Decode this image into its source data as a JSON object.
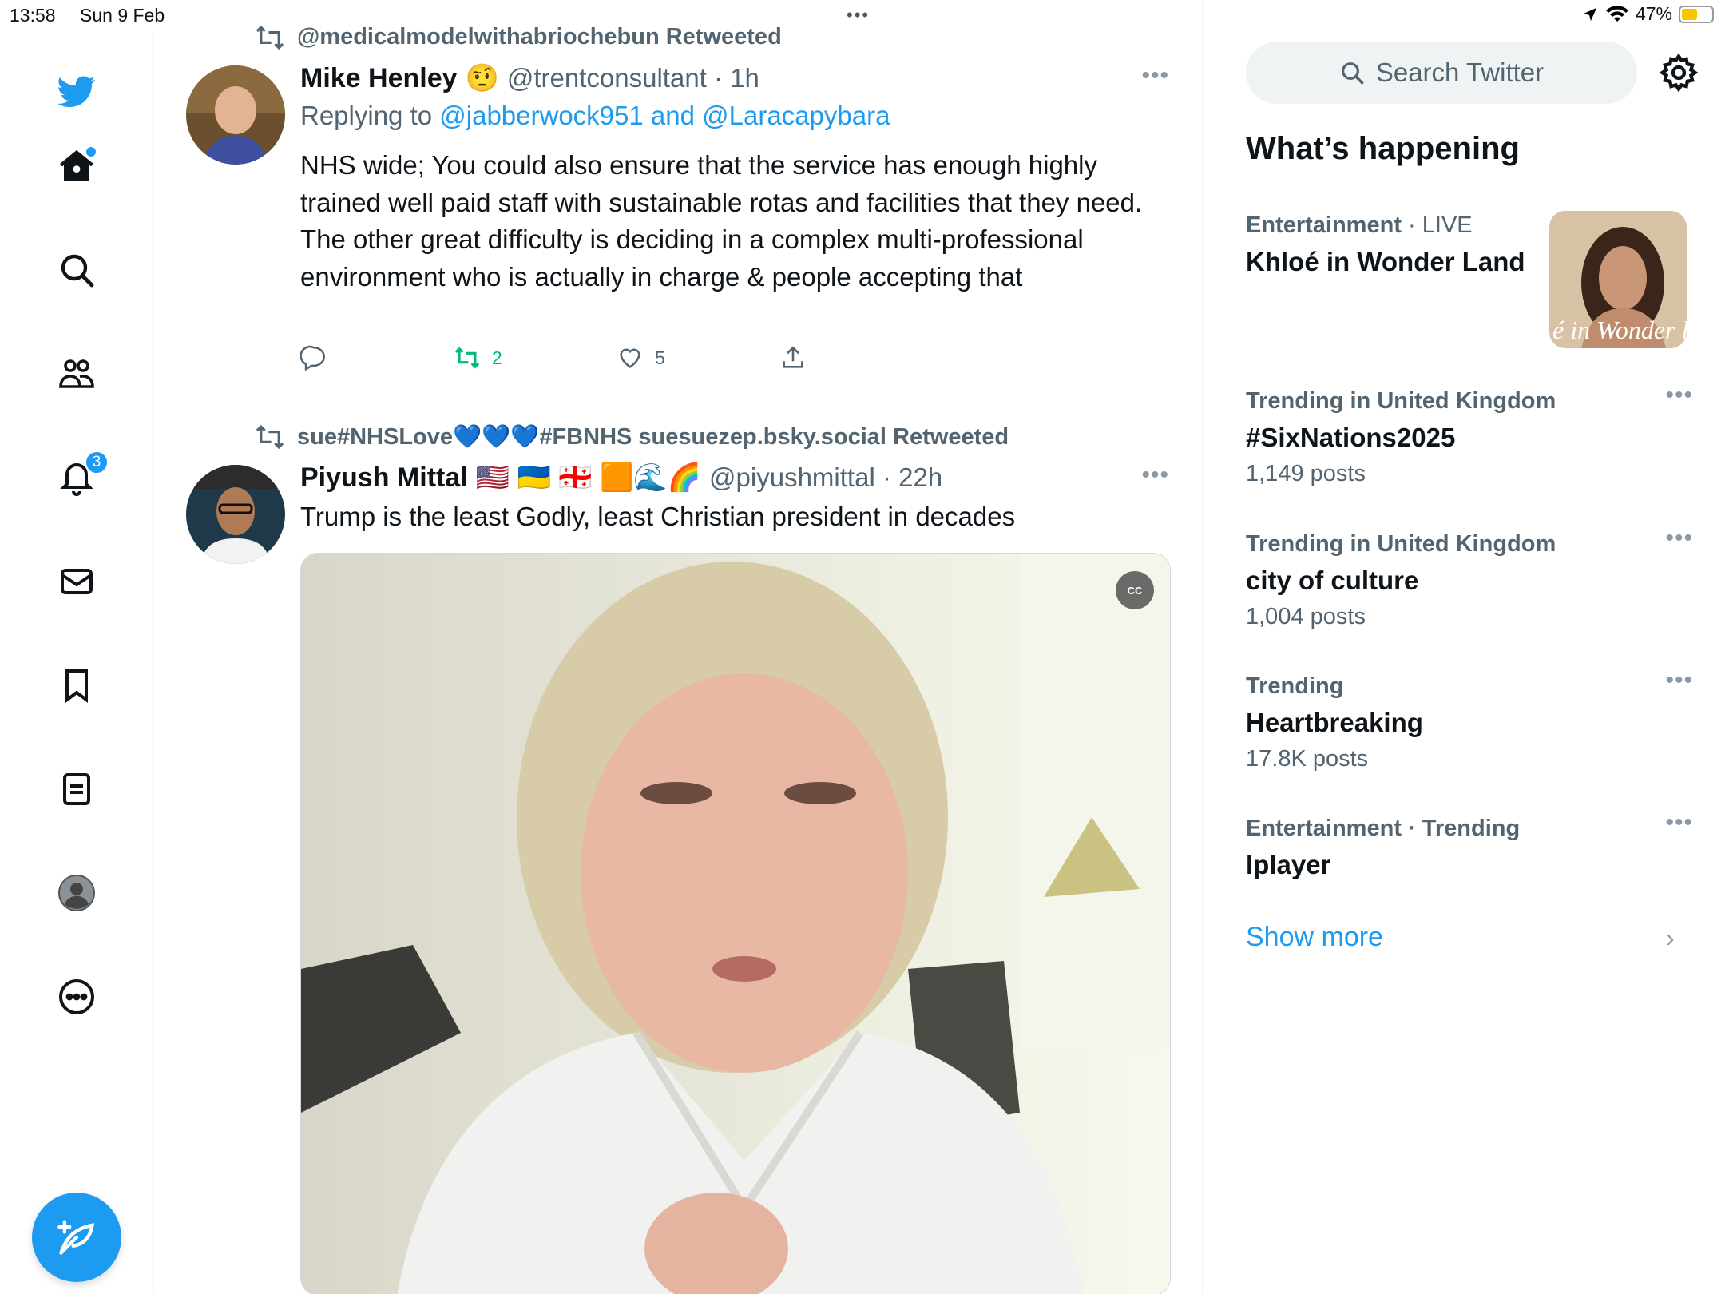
{
  "status_bar": {
    "time": "13:58",
    "date": "Sun 9 Feb",
    "battery": "47%",
    "battery_level": 0.47
  },
  "nav": {
    "notifications_badge": "3"
  },
  "timeline": {
    "tweets": [
      {
        "retweeted_by": "@medicalmodelwithabriochebun Retweeted",
        "name": "Mike Henley",
        "emoji": "🤨",
        "handle": "@trentconsultant · 1h",
        "replying_prefix": "Replying to ",
        "replying_to": "@jabberwock951 and @Laracapybara",
        "text": "NHS wide; You could also ensure that the service has enough highly trained well paid staff with sustainable rotas and facilities that they need. The other great difficulty is deciding in a complex multi-professional environment who is actually in charge & people accepting that",
        "retweets": "2",
        "likes": "5"
      },
      {
        "retweeted_by": "sue#NHSLove💙💙💙#FBNHS suesuezep.bsky.social Retweeted",
        "name": "Piyush Mittal",
        "emoji": "🇺🇸 🇺🇦 🇬🇪 🟧🌊🌈",
        "handle": "@piyushmittal · 22h",
        "text": "Trump is the least Godly, least Christian president in decades",
        "cc_label": "CC"
      }
    ]
  },
  "sidebar": {
    "search_placeholder": "Search Twitter",
    "whats_happening": "What’s happening",
    "trends": [
      {
        "category": "Entertainment",
        "live": " · LIVE",
        "title": "Khloé in Wonder Land",
        "count": ""
      },
      {
        "category": "Trending in United Kingdom",
        "title": "#SixNations2025",
        "count": "1,149 posts"
      },
      {
        "category": "Trending in United Kingdom",
        "title": "city of culture",
        "count": "1,004 posts"
      },
      {
        "category": "Trending",
        "title": "Heartbreaking",
        "count": "17.8K posts"
      },
      {
        "category": "Entertainment · Trending",
        "title": "Iplayer",
        "count": ""
      }
    ],
    "trend_image_caption": "é in Wonder l",
    "show_more": "Show more"
  },
  "colors": {
    "accent": "#1d9bf0",
    "retweet_green": "#00ba7c",
    "secondary_text": "#536471"
  }
}
